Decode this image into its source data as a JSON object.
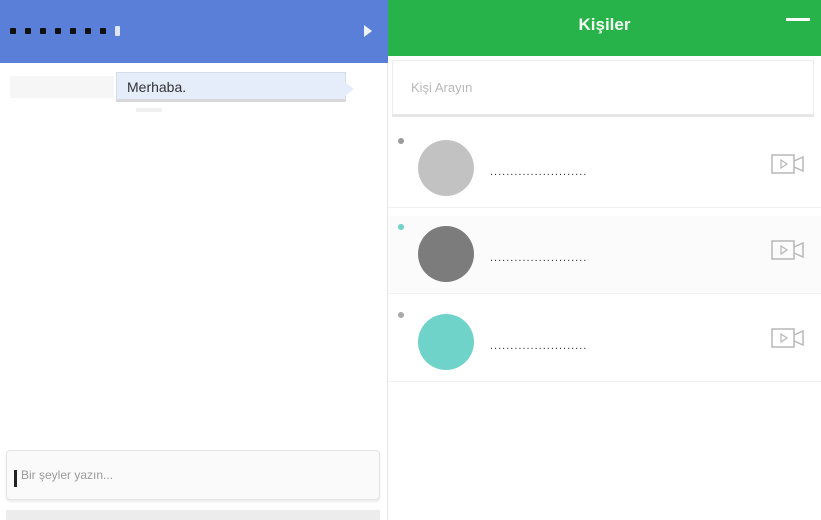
{
  "chat": {
    "header_color": "#5a7fd8",
    "masked_title": "• • • • • • • •",
    "messages": [
      {
        "text": "Merhaba."
      }
    ],
    "composer": {
      "placeholder": "Bir şeyler yazın..."
    }
  },
  "contacts": {
    "title": "Kişiler",
    "header_color": "#27b24a",
    "search": {
      "placeholder": "Kişi Arayın"
    },
    "items": [
      {
        "name": "........................",
        "avatar_color": "#c2c2c2",
        "status_color": "#9a9a9a",
        "icon": "video-call-icon"
      },
      {
        "name": "........................",
        "avatar_color": "#7c7c7c",
        "status_color": "#6fd3c7",
        "icon": "video-call-icon"
      },
      {
        "name": "........................",
        "avatar_color": "#6fd3ca",
        "status_color": "#a8a8a8",
        "icon": "video-call-icon"
      }
    ]
  }
}
